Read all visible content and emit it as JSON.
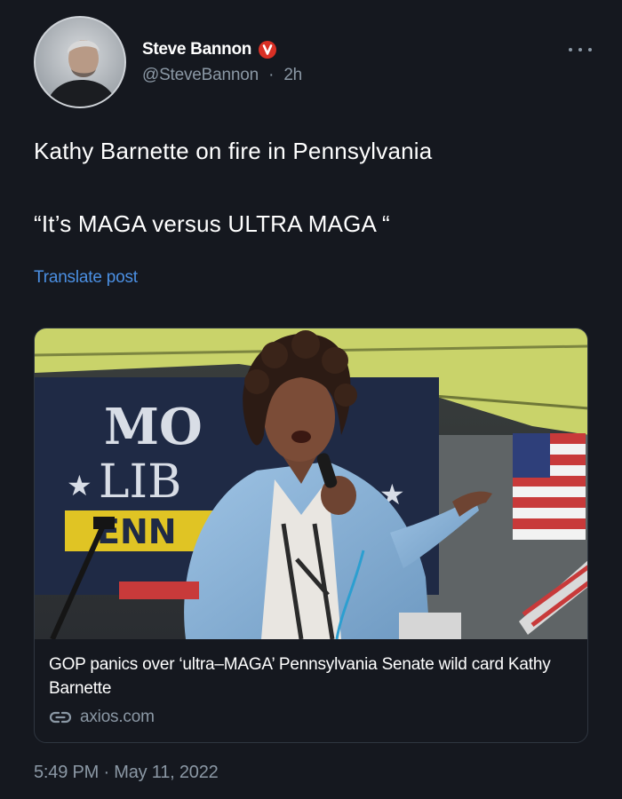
{
  "post": {
    "author": {
      "display_name": "Steve Bannon",
      "handle": "@SteveBannon",
      "separator": "·",
      "time_ago": "2h",
      "verified_badge_icon": "verified-badge-icon",
      "verified_color": "#d93025"
    },
    "text_lines": [
      "Kathy Barnette on fire in Pennsylvania",
      "“It’s MAGA versus ULTRA MAGA “"
    ],
    "translate_label": "Translate post",
    "link_card": {
      "title": "GOP panics over ‘ultra–MAGA’ Pennsylvania Senate wild card Kathy Barnette",
      "domain": "axios.com",
      "link_icon": "link-icon",
      "image_sign_text": [
        "MO",
        "LIB",
        "ENN"
      ]
    },
    "timestamp": "5:49 PM · May 11, 2022"
  },
  "colors": {
    "background": "#15181f",
    "link": "#4b8fe2",
    "secondary_text": "#8b98a5"
  }
}
